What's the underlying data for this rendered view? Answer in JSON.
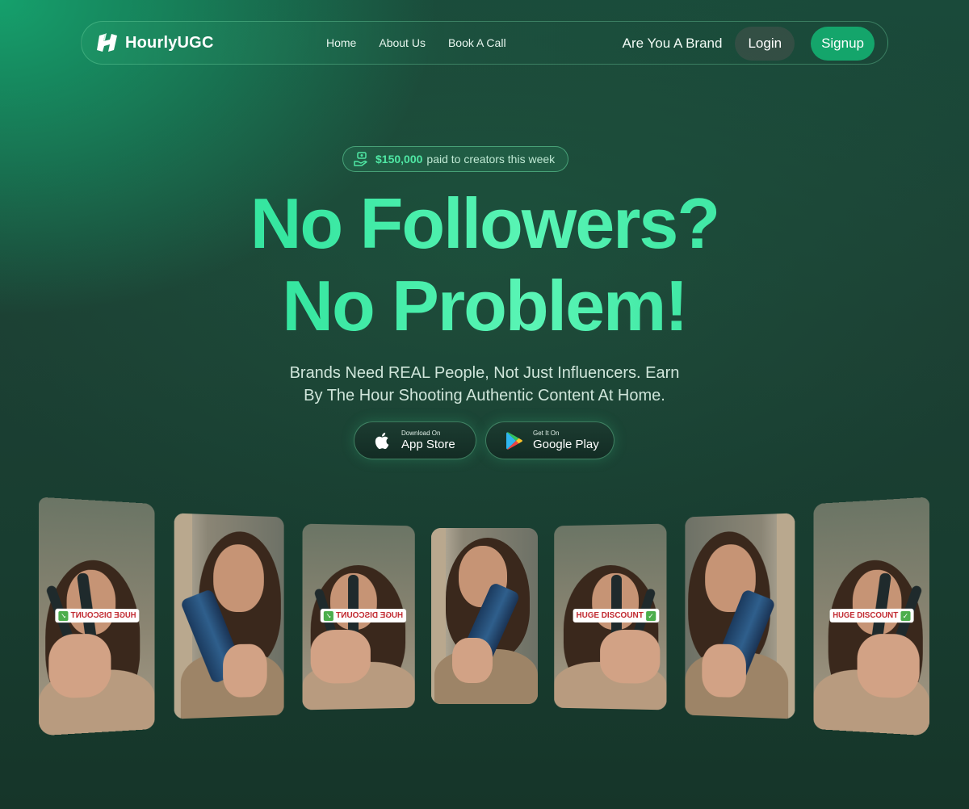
{
  "nav": {
    "brand": "HourlyUGC",
    "links": [
      "Home",
      "About Us",
      "Book A Call"
    ],
    "brand_question": "Are You A Brand",
    "login": "Login",
    "signup": "Signup"
  },
  "badge": {
    "icon": "money-hand-icon",
    "amount": "$150,000",
    "text": "paid to creators this week"
  },
  "hero": {
    "line1": "No Followers?",
    "line2": "No Problem!",
    "sub1": "Brands Need REAL People, Not Just Influencers. Earn",
    "sub2": "By The Hour Shooting Authentic Content At Home."
  },
  "stores": {
    "app_small": "Download On",
    "app_big": "App Store",
    "play_small": "Get It On",
    "play_big": "Google Play"
  },
  "videos": {
    "tag": "HUGE DISCOUNT",
    "check": "✓"
  },
  "colors": {
    "accent": "#14a56b",
    "headline": "#4ff0a8",
    "badge_amount": "#4fe7a4"
  }
}
